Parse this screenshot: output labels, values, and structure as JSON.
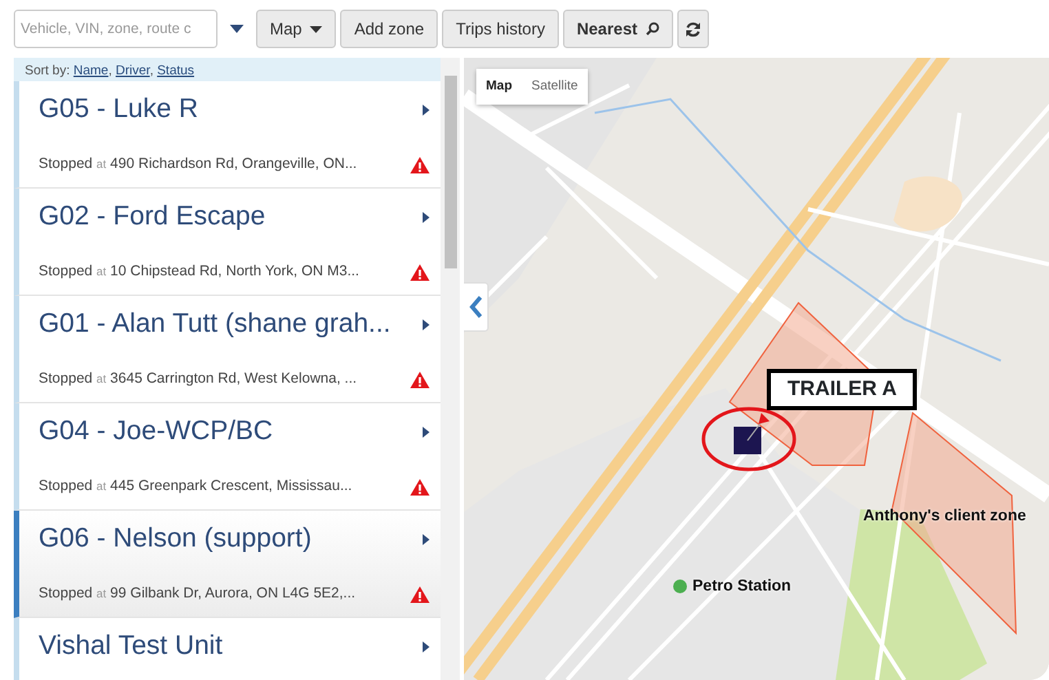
{
  "toolbar": {
    "search": {
      "placeholder": "Vehicle, VIN, zone, route c"
    },
    "buttons": [
      {
        "label": "Map",
        "kind": "dropdown"
      },
      {
        "label": "Add zone",
        "kind": "plain"
      },
      {
        "label": "Trips history",
        "kind": "plain"
      },
      {
        "label": "Nearest",
        "kind": "search"
      },
      {
        "kind": "refresh"
      }
    ]
  },
  "sort_bar": {
    "label": "Sort by:",
    "options": [
      "Name",
      "Driver",
      "Status"
    ],
    "separator": ","
  },
  "vehicles": [
    {
      "name": "G05 - Luke R",
      "status": "Stopped",
      "preposition": "at",
      "address": "490 Richardson Rd, Orangeville, ON...",
      "alert": true,
      "selected": false
    },
    {
      "name": "G02 - Ford Escape",
      "status": "Stopped",
      "preposition": "at",
      "address": "10 Chipstead Rd, North York, ON M3...",
      "alert": true,
      "selected": false
    },
    {
      "name": "G01 - Alan Tutt (shane grah...",
      "status": "Stopped",
      "preposition": "at",
      "address": "3645 Carrington Rd, West Kelowna, ...",
      "alert": true,
      "selected": false
    },
    {
      "name": "G04 - Joe-WCP/BC",
      "status": "Stopped",
      "preposition": "at",
      "address": "445 Greenpark Crescent, Mississau...",
      "alert": true,
      "selected": false
    },
    {
      "name": "G06 - Nelson (support)",
      "status": "Stopped",
      "preposition": "at",
      "address": "99 Gilbank Dr, Aurora, ON L4G 5E2,...",
      "alert": true,
      "selected": true
    },
    {
      "name": "Vishal Test Unit",
      "selected": false
    }
  ],
  "map": {
    "types": [
      {
        "label": "Map",
        "selected": true
      },
      {
        "label": "Satellite",
        "selected": false
      }
    ],
    "markers": [
      {
        "label": "TRAILER A",
        "kind": "vehicle"
      },
      {
        "label": "Anthony's client zone",
        "kind": "zone"
      },
      {
        "label": "Petro Station",
        "kind": "place"
      }
    ]
  }
}
